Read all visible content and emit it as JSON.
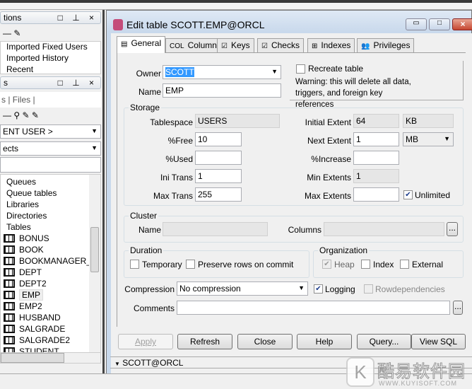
{
  "left": {
    "panel1_title": "tions",
    "panel1_items": [
      "Imported Fixed Users",
      "Imported History",
      "Recent"
    ],
    "panel2_title": "s",
    "tabs": [
      "s",
      "Files"
    ],
    "user_select": "ENT USER >",
    "type_select": "ects",
    "tree_folders": [
      "Queues",
      "Queue tables",
      "Libraries",
      "Directories",
      "Tables"
    ],
    "tree_tables": [
      "BONUS",
      "BOOK",
      "BOOKMANAGER_U",
      "DEPT",
      "DEPT2",
      "EMP",
      "EMP2",
      "HUSBAND",
      "SALGRADE",
      "SALGRADE2",
      "STUDENT"
    ],
    "selected": "EMP",
    "panel_controls": "□ ⊥ ×"
  },
  "dialog": {
    "title": "Edit table SCOTT.EMP@ORCL",
    "tabs": [
      "General",
      "Columns",
      "Keys",
      "Checks",
      "Indexes",
      "Privileges"
    ],
    "owner_label": "Owner",
    "owner": "SCOTT",
    "name_label": "Name",
    "name": "EMP",
    "recreate_label": "Recreate table",
    "warning": "Warning: this will delete all data, triggers, and foreign key references",
    "storage": {
      "title": "Storage",
      "tablespace_label": "Tablespace",
      "tablespace": "USERS",
      "free_label": "%Free",
      "free": "10",
      "used_label": "%Used",
      "used": "",
      "initrans_label": "Ini Trans",
      "initrans": "1",
      "maxtrans_label": "Max Trans",
      "maxtrans": "255",
      "initial_label": "Initial Extent",
      "initial": "64",
      "initial_unit": "KB",
      "next_label": "Next Extent",
      "next": "1",
      "next_unit": "MB",
      "increase_label": "%Increase",
      "increase": "",
      "minext_label": "Min Extents",
      "minext": "1",
      "maxext_label": "Max Extents",
      "maxext": "",
      "unlimited_label": "Unlimited"
    },
    "cluster": {
      "title": "Cluster",
      "name_label": "Name",
      "columns_label": "Columns",
      "more": "..."
    },
    "duration": {
      "title": "Duration",
      "temporary": "Temporary",
      "preserve": "Preserve rows on commit"
    },
    "organization": {
      "title": "Organization",
      "heap": "Heap",
      "index": "Index",
      "external": "External"
    },
    "compression_label": "Compression",
    "compression": "No compression",
    "logging": "Logging",
    "rowdep": "Rowdependencies",
    "comments_label": "Comments",
    "comments": "",
    "buttons": {
      "apply": "Apply",
      "refresh": "Refresh",
      "close": "Close",
      "help": "Help",
      "query": "Query...",
      "viewsql": "View SQL"
    },
    "connection": "SCOTT@ORCL"
  },
  "watermark": {
    "name": "酷易软件园",
    "url": "WWW.KUYISOFT.COM"
  }
}
